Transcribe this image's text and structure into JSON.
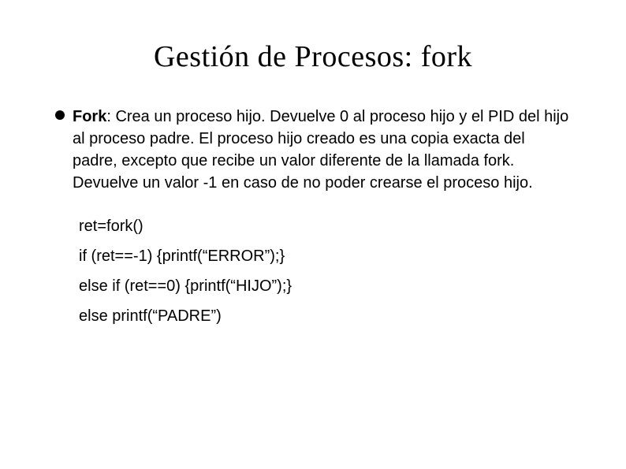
{
  "title": "Gestión de Procesos: fork",
  "bullet": {
    "term": "Fork",
    "text": ": Crea un proceso hijo. Devuelve 0 al proceso hijo y el PID del hijo al proceso padre. El proceso hijo creado es una copia exacta del padre, excepto que recibe un valor diferente de la llamada fork. Devuelve un valor -1 en caso de no poder crearse el proceso hijo."
  },
  "code": {
    "l1": "ret=fork()",
    "l2": "if (ret==-1) {printf(“ERROR”);}",
    "l3": "else if (ret==0) {printf(“HIJO”);}",
    "l4": "else printf(“PADRE”)"
  }
}
